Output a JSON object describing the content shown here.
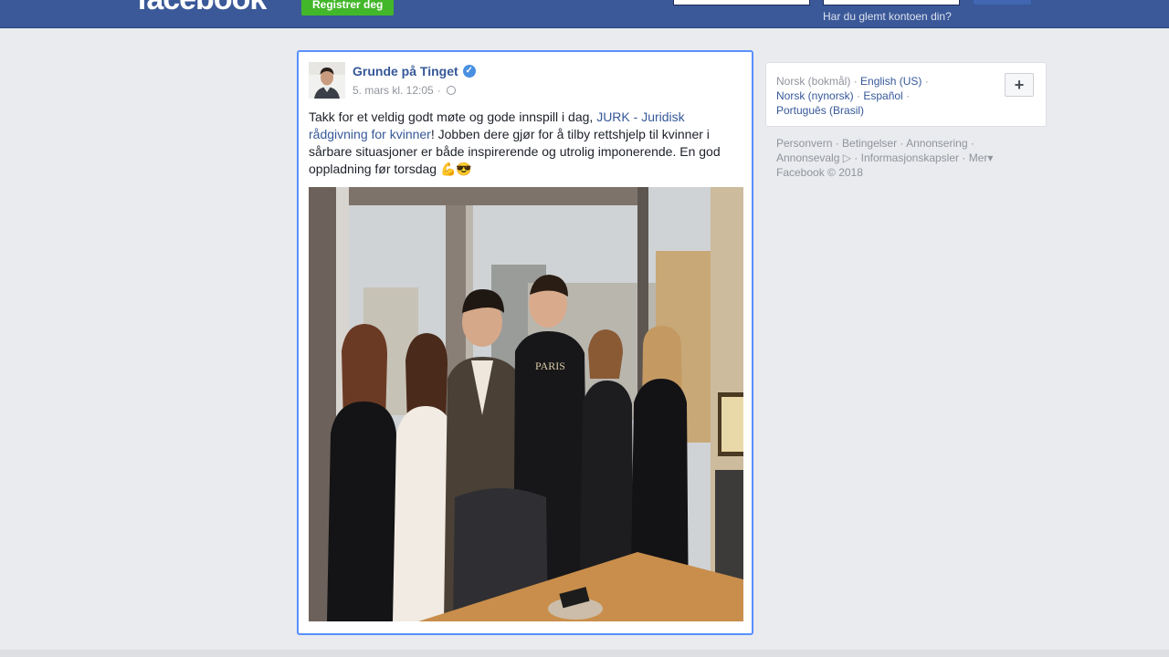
{
  "header": {
    "logo": "facebook",
    "register_label": "Registrer deg",
    "forgot_account": "Har du glemt kontoen din?"
  },
  "post": {
    "author": "Grunde på Tinget",
    "timestamp": "5. mars kl. 12:05",
    "separator": "·",
    "text_before": "Takk for et veldig godt møte og gode innspill i dag, ",
    "link_text": "JURK - Juridisk rådgivning for kvinner",
    "text_after": "! Jobben dere gjør for å tilby rettshjelp til kvinner i sårbare situasjoner er både inspirerende og utrolig imponerende. En god oppladning før torsdag 💪😎",
    "photo_shirt_text": "PARIS"
  },
  "languages": {
    "current": "Norsk (bokmål)",
    "items": [
      "English (US)",
      "Norsk (nynorsk)",
      "Español",
      "Português (Brasil)"
    ],
    "add_label": "+"
  },
  "footer": {
    "links": [
      "Personvern",
      "Betingelser",
      "Annonsering",
      "Annonsevalg",
      "Informasjonskapsler",
      "Mer"
    ],
    "copyright": "Facebook © 2018"
  },
  "colors": {
    "brand_blue": "#3b5998",
    "link_blue": "#365899",
    "register_green": "#42b72a",
    "focus_border": "#5890ff"
  }
}
